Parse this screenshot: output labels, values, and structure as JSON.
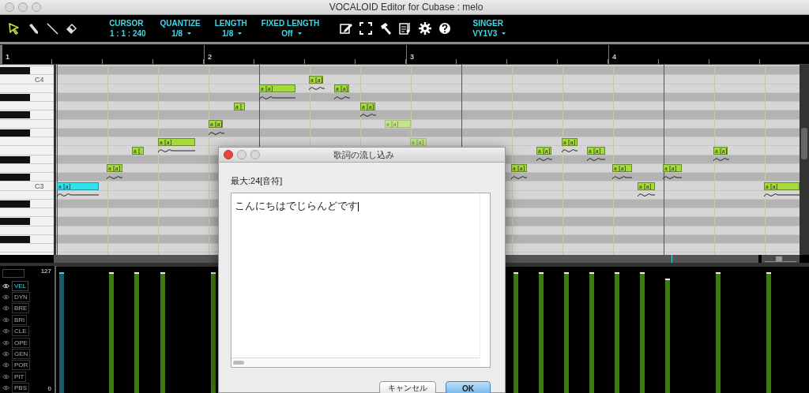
{
  "window": {
    "title": "VOCALOID Editor for Cubase : melo"
  },
  "tools": [
    {
      "kind": "select",
      "selected": true
    },
    {
      "kind": "pencil",
      "selected": false
    },
    {
      "kind": "line",
      "selected": false
    },
    {
      "kind": "eraser",
      "selected": false
    }
  ],
  "settings": [
    {
      "label": "CURSOR",
      "value": "1 : 1 : 240",
      "dropdown": false
    },
    {
      "label": "QUANTIZE",
      "value": "1/8",
      "dropdown": true
    },
    {
      "label": "LENGTH",
      "value": "1/8",
      "dropdown": true
    },
    {
      "label": "FIXED LENGTH",
      "value": "Off",
      "dropdown": true
    }
  ],
  "singer": {
    "label": "SINGER",
    "value": "VY1V3"
  },
  "ruler": {
    "measures": [
      "1",
      "2",
      "3",
      "4"
    ]
  },
  "keyboard": {
    "labels": [
      "C4",
      "C3"
    ]
  },
  "zoom_slider": {
    "level": 0.45
  },
  "notes": [
    {
      "lyric": "a [a]",
      "selected": true,
      "dimmed": false,
      "vibrato": true
    },
    {
      "lyric": "a [a]",
      "selected": false,
      "dimmed": false,
      "vibrato": true
    },
    {
      "lyric": "a [",
      "selected": false,
      "dimmed": false,
      "vibrato": false
    },
    {
      "lyric": "a [a]",
      "selected": false,
      "dimmed": false,
      "vibrato": true
    },
    {
      "lyric": "a [a]",
      "selected": false,
      "dimmed": false,
      "vibrato": true
    },
    {
      "lyric": "a [",
      "selected": false,
      "dimmed": false,
      "vibrato": false
    },
    {
      "lyric": "a [a]",
      "selected": false,
      "dimmed": false,
      "vibrato": true
    },
    {
      "lyric": "a [a]",
      "selected": false,
      "dimmed": false,
      "vibrato": true
    },
    {
      "lyric": "a [a]",
      "selected": false,
      "dimmed": false,
      "vibrato": true
    },
    {
      "lyric": "a [a]",
      "selected": false,
      "dimmed": false,
      "vibrato": true
    },
    {
      "lyric": "a [a]",
      "selected": false,
      "dimmed": true,
      "vibrato": false
    },
    {
      "lyric": "a [a]",
      "selected": false,
      "dimmed": true,
      "vibrato": false
    },
    {
      "lyric": "a [a]",
      "selected": false,
      "dimmed": false,
      "vibrato": true
    },
    {
      "lyric": "a [a]",
      "selected": false,
      "dimmed": false,
      "vibrato": true
    },
    {
      "lyric": "a [a]",
      "selected": false,
      "dimmed": false,
      "vibrato": true
    },
    {
      "lyric": "a [a]",
      "selected": false,
      "dimmed": false,
      "vibrato": true
    },
    {
      "lyric": "a [a]",
      "selected": false,
      "dimmed": false,
      "vibrato": true
    },
    {
      "lyric": "a [a]",
      "selected": false,
      "dimmed": false,
      "vibrato": true
    },
    {
      "lyric": "a [a]",
      "selected": false,
      "dimmed": false,
      "vibrato": true
    },
    {
      "lyric": "a [a]",
      "selected": false,
      "dimmed": false,
      "vibrato": true
    },
    {
      "lyric": "a [a]",
      "selected": false,
      "dimmed": false,
      "vibrato": true
    }
  ],
  "velocity_panel": {
    "max": "127",
    "min": "0",
    "parameters": [
      {
        "label": "VEL",
        "selected": true
      },
      {
        "label": "DYN",
        "selected": false
      },
      {
        "label": "BRE",
        "selected": false
      },
      {
        "label": "BRI",
        "selected": false
      },
      {
        "label": "CLE",
        "selected": false
      },
      {
        "label": "OPE",
        "selected": false
      },
      {
        "label": "GEN",
        "selected": false
      },
      {
        "label": "POR",
        "selected": false
      },
      {
        "label": "PIT",
        "selected": false
      },
      {
        "label": "PBS",
        "selected": false
      }
    ]
  },
  "dialog": {
    "title": "歌詞の流し込み",
    "limit_label": "最大:24[音符]",
    "lyrics_value": "こんにちはでじらんどです",
    "buttons": [
      {
        "label": "キャンセル",
        "default": false
      },
      {
        "label": "OK",
        "default": true
      }
    ]
  }
}
